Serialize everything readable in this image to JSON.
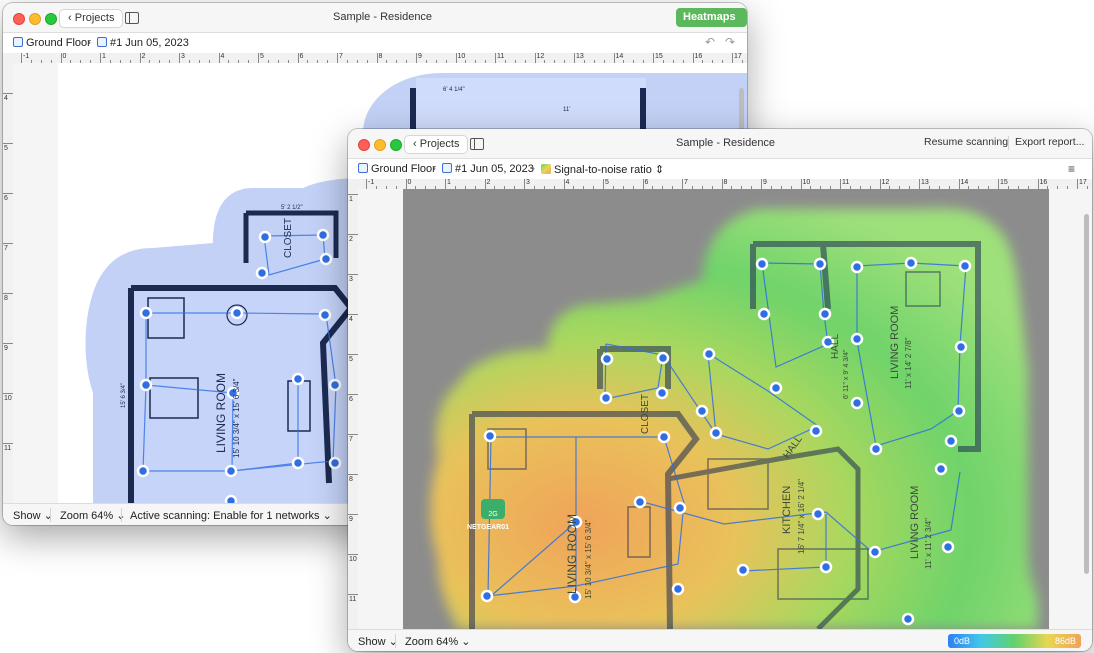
{
  "back_window": {
    "title": "Sample - Residence",
    "projects_label": "Projects",
    "heatmaps_label": "Heatmaps",
    "breadcrumb": {
      "floor": "Ground Floor",
      "scan": "#1 Jun 05, 2023"
    },
    "ruler_top": [
      "-1",
      "0",
      "1",
      "2",
      "3",
      "4",
      "5",
      "6",
      "7",
      "8",
      "9",
      "10",
      "11",
      "12",
      "13",
      "14",
      "15",
      "16",
      "17"
    ],
    "ruler_left": [
      "4",
      "5",
      "6",
      "7",
      "8",
      "9",
      "10",
      "11"
    ],
    "plan_labels": {
      "closet": "CLOSET",
      "room": "LIVING ROOM",
      "room_dims": "15' 10 3/4\" x 15' 6 3/4\"",
      "dim_a": "6' 4 1/4\"",
      "dim_b": "11'",
      "dim_c": "5' 2 1/2\"",
      "dim_d": "15' 6 3/4\""
    },
    "status": {
      "show": "Show",
      "zoom": "Zoom 64%",
      "scanning": "Active scanning: Enable for 1 networks"
    }
  },
  "front_window": {
    "title": "Sample - Residence",
    "projects_label": "Projects",
    "resume_label": "Resume scanning",
    "export_label": "Export report...",
    "breadcrumb": {
      "floor": "Ground Floor",
      "scan": "#1 Jun 05, 2023",
      "view": "Signal-to-noise ratio"
    },
    "ruler_top": [
      "-1",
      "0",
      "1",
      "2",
      "3",
      "4",
      "5",
      "6",
      "7",
      "8",
      "9",
      "10",
      "11",
      "12",
      "13",
      "14",
      "15",
      "16",
      "17"
    ],
    "ruler_left": [
      "1",
      "2",
      "3",
      "4",
      "5",
      "6",
      "7",
      "8",
      "9",
      "10",
      "11"
    ],
    "plan_labels": {
      "closet": "CLOSET",
      "hall": "HALL",
      "hall2": "HALL",
      "living": "LIVING ROOM",
      "living_dims": "15' 10 3/4\" x 15' 6 3/4\"",
      "kitchen": "KITCHEN",
      "kitchen_dims": "16' 7 1/4\" x 16' 2 1/4\"",
      "living2": "LIVING ROOM",
      "living2_dims": "11' x 14' 2 7/8\"",
      "living3": "LIVING ROOM",
      "living3_dims": "11' x 11' 2 3/4\"",
      "hall_dims": "6' 11\" x 9' 4 3/4\""
    },
    "access_point": {
      "band": "2G",
      "name": "NETGEAR01"
    },
    "status": {
      "show": "Show",
      "zoom": "Zoom 64%"
    },
    "legend": {
      "min": "0dB",
      "max": "86dB"
    }
  },
  "colors": {
    "node": "#2f6fe3",
    "wall": "#1c2a52",
    "heatmaps_btn": "#5cb85c",
    "floor_gray": "#8c8c8c"
  }
}
